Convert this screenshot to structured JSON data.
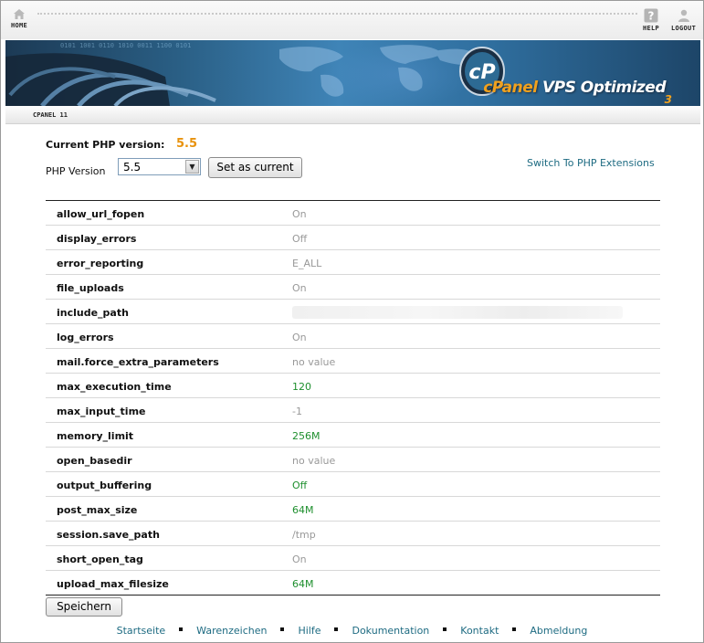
{
  "nav": {
    "home_label": "HOME",
    "help_label": "HELP",
    "logout_label": "LOGOUT"
  },
  "banner": {
    "brand": "cPanel",
    "product": "VPS Optimized",
    "edition": "3",
    "logo_letters": "cP"
  },
  "strip": {
    "version_label": "CPANEL 11"
  },
  "php": {
    "current_label": "Current PHP version:",
    "current_value": "5.5",
    "version_label": "PHP Version",
    "selected_version": "5.5",
    "set_button": "Set as current",
    "switch_link": "Switch To PHP Extensions"
  },
  "directives": [
    {
      "name": "allow_url_fopen",
      "value": "On",
      "changed": false
    },
    {
      "name": "display_errors",
      "value": "Off",
      "changed": false
    },
    {
      "name": "error_reporting",
      "value": "E_ALL",
      "changed": false
    },
    {
      "name": "file_uploads",
      "value": "On",
      "changed": false
    },
    {
      "name": "include_path",
      "value": "",
      "changed": false,
      "blurred": true
    },
    {
      "name": "log_errors",
      "value": "On",
      "changed": false
    },
    {
      "name": "mail.force_extra_parameters",
      "value": "no value",
      "changed": false
    },
    {
      "name": "max_execution_time",
      "value": "120",
      "changed": true
    },
    {
      "name": "max_input_time",
      "value": "-1",
      "changed": false
    },
    {
      "name": "memory_limit",
      "value": "256M",
      "changed": true
    },
    {
      "name": "open_basedir",
      "value": "no value",
      "changed": false
    },
    {
      "name": "output_buffering",
      "value": "Off",
      "changed": true
    },
    {
      "name": "post_max_size",
      "value": "64M",
      "changed": true
    },
    {
      "name": "session.save_path",
      "value": "/tmp",
      "changed": false
    },
    {
      "name": "short_open_tag",
      "value": "On",
      "changed": false
    },
    {
      "name": "upload_max_filesize",
      "value": "64M",
      "changed": true
    }
  ],
  "save_button": "Speichern",
  "footer": [
    "Startseite",
    "Warenzeichen",
    "Hilfe",
    "Dokumentation",
    "Kontakt",
    "Abmeldung"
  ],
  "colors": {
    "current_version": "#e8920c",
    "changed_value": "#1e8f2e",
    "default_value": "#999999",
    "link": "#1e6b82"
  }
}
